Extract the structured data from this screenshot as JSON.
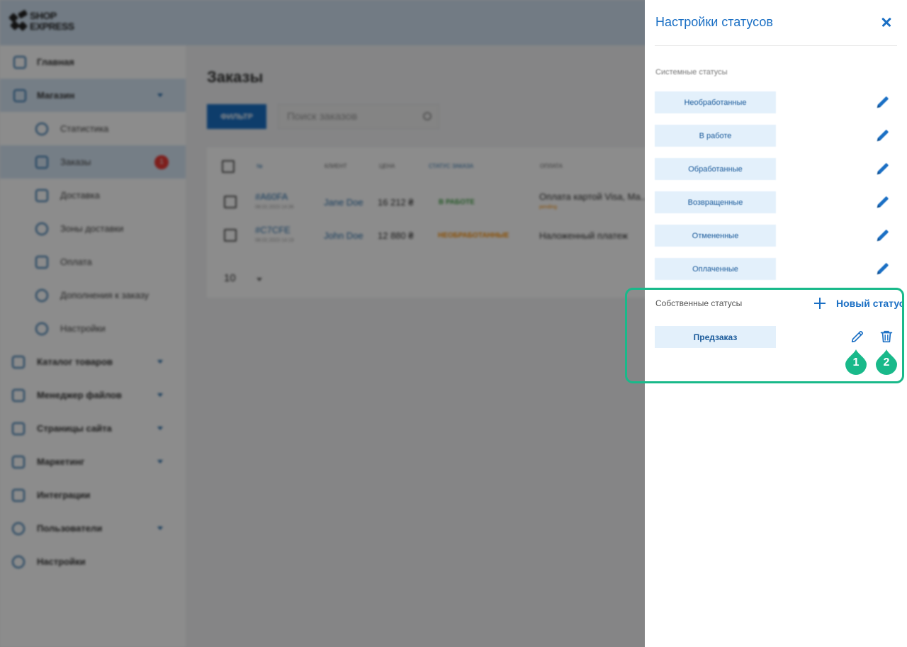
{
  "app": {
    "logo_line1": "SHOP",
    "logo_line2": "EXPRESS"
  },
  "sidebar": {
    "items": [
      {
        "label": "Главная",
        "icon": "home-icon"
      },
      {
        "label": "Магазин",
        "icon": "cart-icon",
        "expanded": true
      },
      {
        "label": "Статистика",
        "icon": "chart-pie-icon"
      },
      {
        "label": "Заказы",
        "icon": "basket-icon",
        "badge": "1"
      },
      {
        "label": "Доставка",
        "icon": "truck-icon"
      },
      {
        "label": "Зоны доставки",
        "icon": "globe-icon"
      },
      {
        "label": "Оплата",
        "icon": "credit-card-icon"
      },
      {
        "label": "Дополнения к заказу",
        "icon": "plus-circle-icon"
      },
      {
        "label": "Настройки",
        "icon": "gear-icon"
      },
      {
        "label": "Каталог товаров",
        "icon": "book-icon"
      },
      {
        "label": "Менеджер файлов",
        "icon": "folder-icon"
      },
      {
        "label": "Страницы сайта",
        "icon": "page-icon"
      },
      {
        "label": "Маркетинг",
        "icon": "megaphone-icon"
      },
      {
        "label": "Интеграции",
        "icon": "plug-icon"
      },
      {
        "label": "Пользователи",
        "icon": "user-icon"
      },
      {
        "label": "Настройки",
        "icon": "gear-icon"
      }
    ]
  },
  "main": {
    "title": "Заказы",
    "filter_label": "ФИЛЬТР",
    "search_placeholder": "Поиск заказов",
    "table": {
      "headers": [
        "№",
        "КЛИЕНТ",
        "ЦЕНА",
        "СТАТУС ЗАКАЗА",
        "ОПЛАТА"
      ],
      "rows": [
        {
          "id": "#A60FA",
          "date": "08.02.2023 14:36",
          "client": "Jane Doe",
          "price": "16 212 ₴",
          "status": "В РАБОТЕ",
          "payment": "Оплата картой Visa, Ma...",
          "payment_note": "pending"
        },
        {
          "id": "#C7CFE",
          "date": "08.02.2023 14:19",
          "client": "John Doe",
          "price": "12 880 ₴",
          "status": "НЕОБРАБОТАННЫЕ",
          "payment": "Наложенный платеж",
          "payment_note": ""
        }
      ]
    },
    "page_size": "10"
  },
  "panel": {
    "title": "Настройки статусов",
    "system_label": "Системные статусы",
    "system_statuses": [
      "Необработанные",
      "В работе",
      "Обработанные",
      "Возвращенные",
      "Отмененные",
      "Оплаченные"
    ],
    "custom_label": "Собственные статусы",
    "new_status_label": "Новый статус",
    "custom_statuses": [
      "Предзаказ"
    ]
  },
  "markers": [
    "1",
    "2"
  ],
  "colors": {
    "accent": "#1a6fc4",
    "chip_bg": "#e3f0fb",
    "highlight": "#19b98a"
  }
}
